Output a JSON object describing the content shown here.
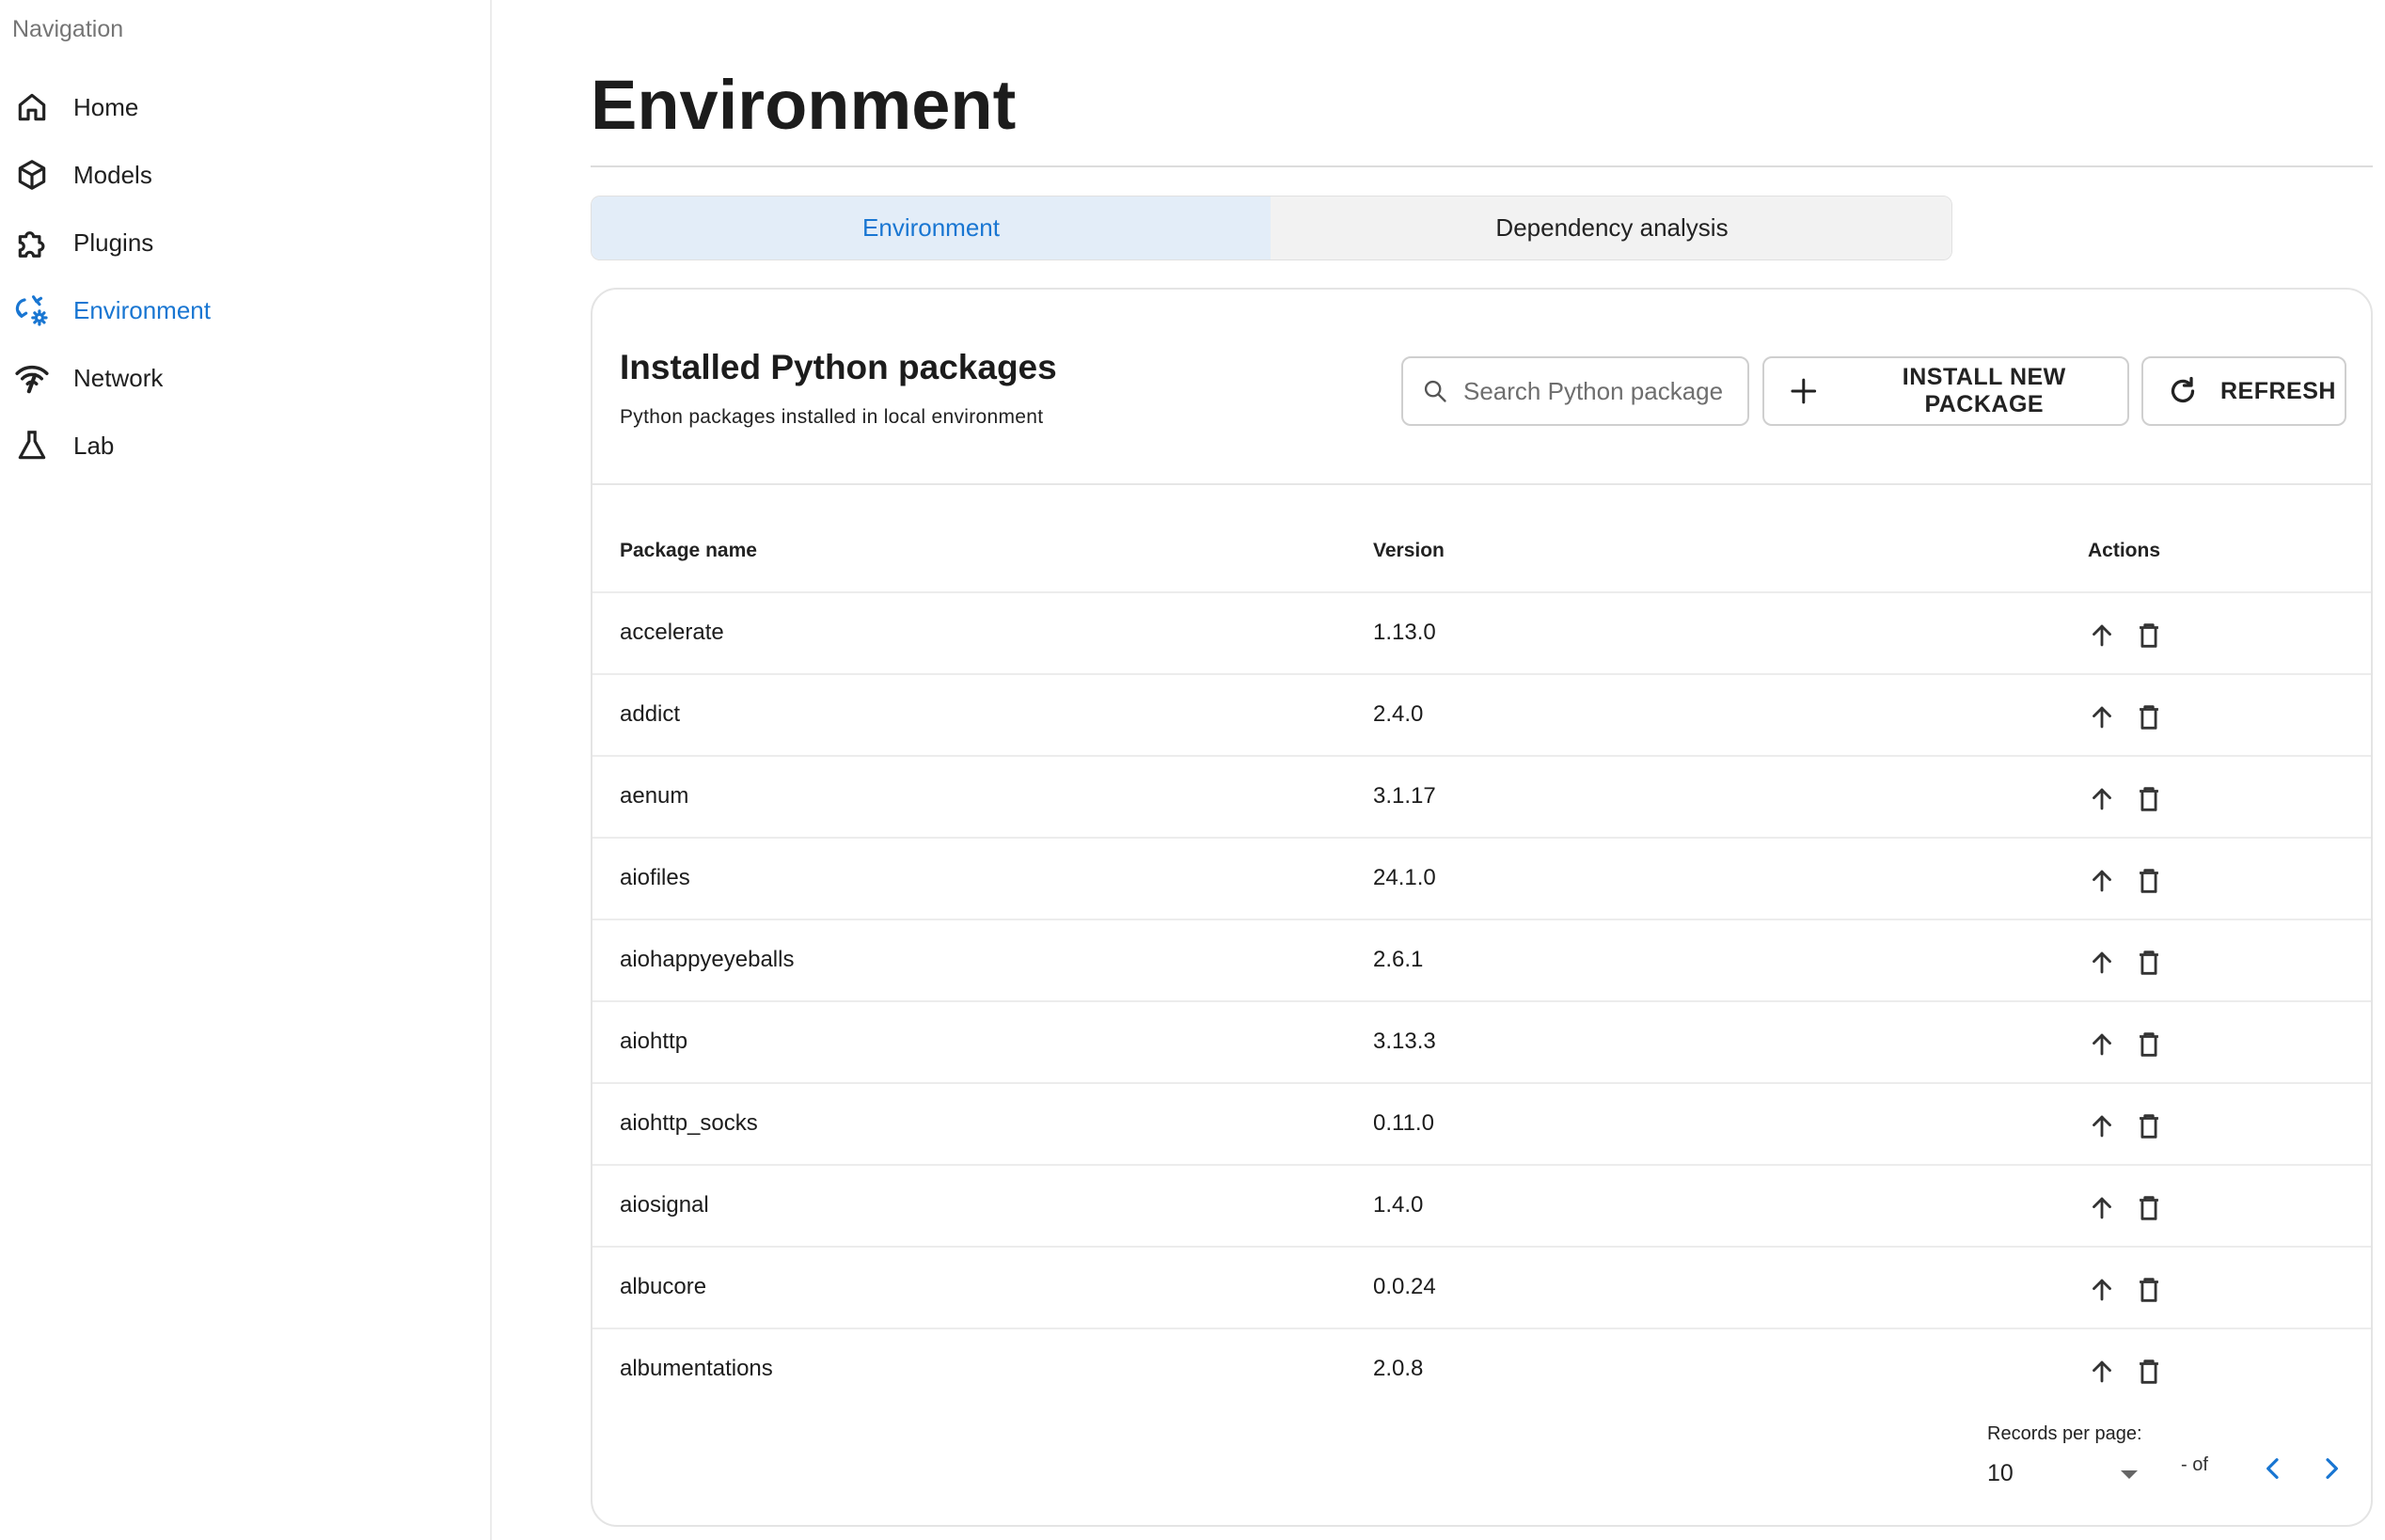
{
  "sidebar": {
    "title": "Navigation",
    "items": [
      {
        "label": "Home",
        "icon": "home-icon"
      },
      {
        "label": "Models",
        "icon": "cube-icon"
      },
      {
        "label": "Plugins",
        "icon": "puzzle-icon"
      },
      {
        "label": "Environment",
        "icon": "environment-sync-icon",
        "active": true
      },
      {
        "label": "Network",
        "icon": "network-icon"
      },
      {
        "label": "Lab",
        "icon": "flask-icon"
      }
    ]
  },
  "page": {
    "title": "Environment",
    "tabs": [
      {
        "label": "Environment",
        "active": true
      },
      {
        "label": "Dependency analysis",
        "active": false
      }
    ]
  },
  "card": {
    "title": "Installed Python packages",
    "subtitle": "Python packages installed in local environment",
    "search_placeholder": "Search Python package",
    "install_label": "INSTALL NEW PACKAGE",
    "refresh_label": "REFRESH"
  },
  "table": {
    "headers": {
      "name": "Package name",
      "version": "Version",
      "actions": "Actions"
    },
    "rows": [
      {
        "name": "accelerate",
        "version": "1.13.0"
      },
      {
        "name": "addict",
        "version": "2.4.0"
      },
      {
        "name": "aenum",
        "version": "3.1.17"
      },
      {
        "name": "aiofiles",
        "version": "24.1.0"
      },
      {
        "name": "aiohappyeyeballs",
        "version": "2.6.1"
      },
      {
        "name": "aiohttp",
        "version": "3.13.3"
      },
      {
        "name": "aiohttp_socks",
        "version": "0.11.0"
      },
      {
        "name": "aiosignal",
        "version": "1.4.0"
      },
      {
        "name": "albucore",
        "version": "0.0.24"
      },
      {
        "name": "albumentations",
        "version": "2.0.8"
      }
    ]
  },
  "footer": {
    "records_label": "Records per page:",
    "records_value": "10",
    "range_text": "- of"
  },
  "colors": {
    "accent": "#1976d2",
    "active_tab_bg": "#e3edf8",
    "inactive_tab_bg": "#f2f2f2",
    "border": "#e4e4e4"
  }
}
